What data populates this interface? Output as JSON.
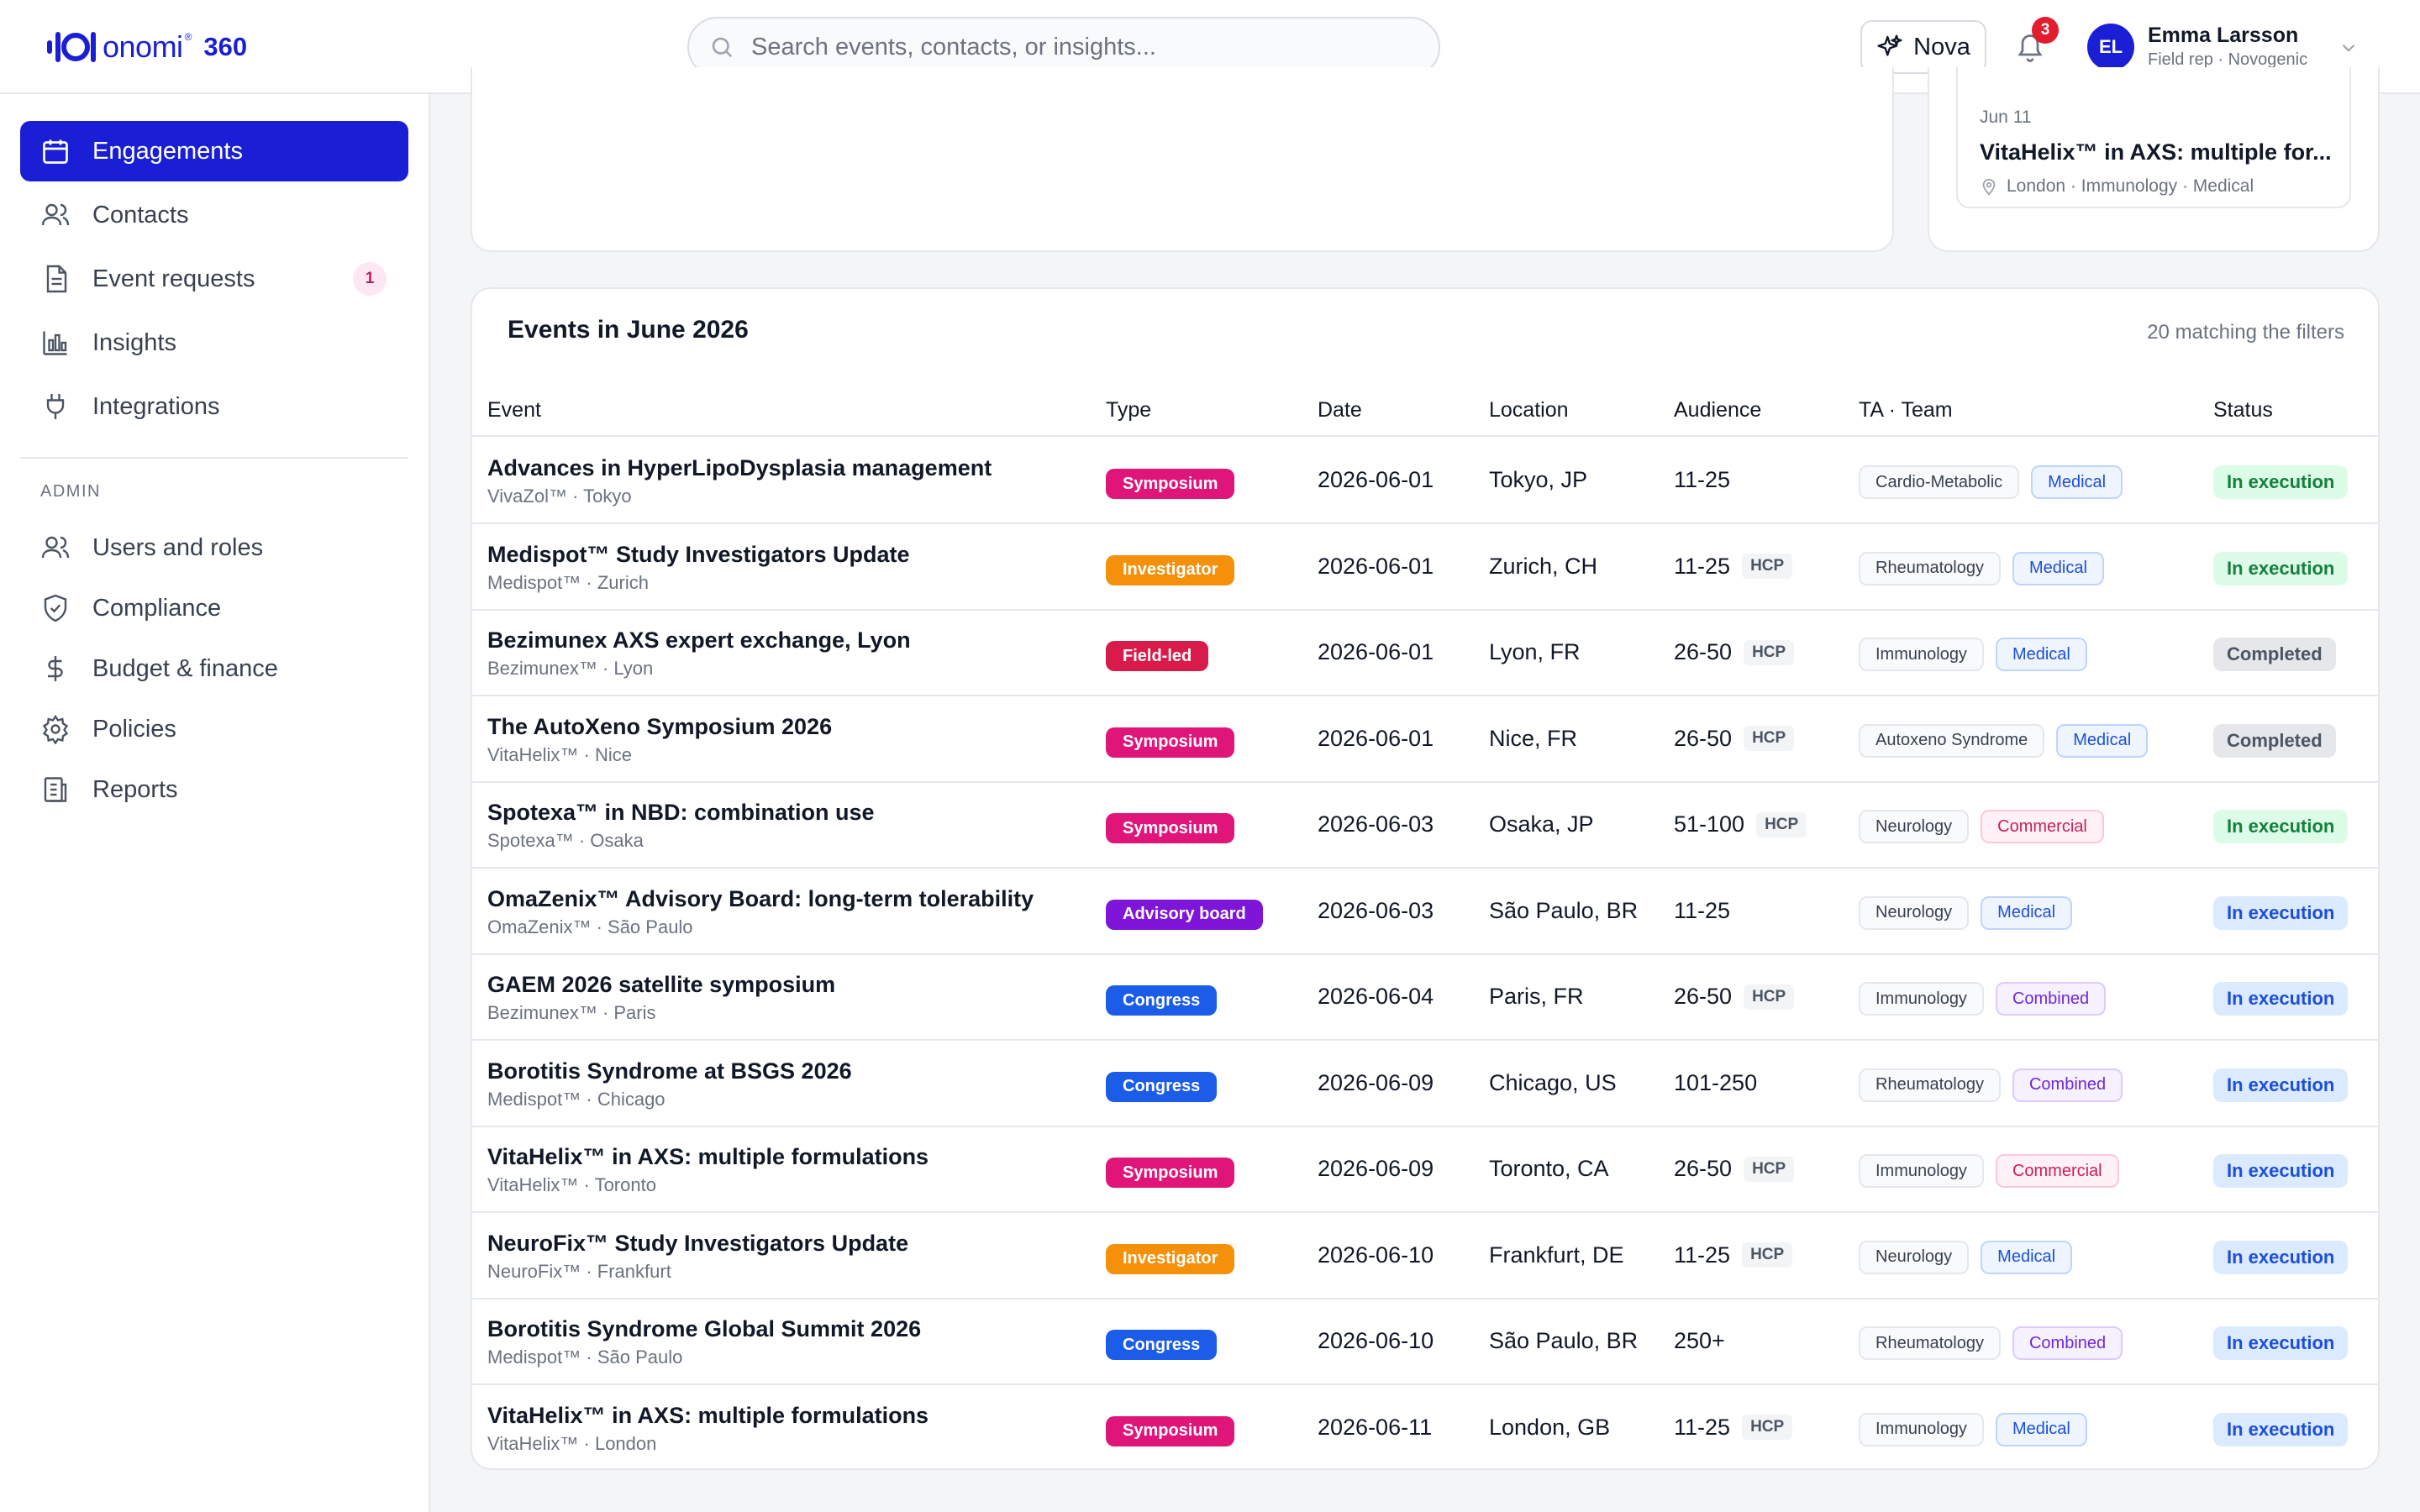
{
  "brand": {
    "name": "onomi",
    "product": "360",
    "reg": "®",
    "accent": "#1a1fd6"
  },
  "search": {
    "placeholder": "Search events, contacts, or insights..."
  },
  "header": {
    "nova_label": "Nova",
    "notifications_count": "3",
    "user": {
      "initials": "EL",
      "name": "Emma Larsson",
      "role": "Field rep · Novogenic"
    }
  },
  "sidebar": {
    "items": [
      {
        "label": "Engagements",
        "icon": "calendar-icon",
        "active": true
      },
      {
        "label": "Contacts",
        "icon": "users-icon"
      },
      {
        "label": "Event requests",
        "icon": "document-icon",
        "badge": "1"
      },
      {
        "label": "Insights",
        "icon": "bar-chart-icon"
      },
      {
        "label": "Integrations",
        "icon": "plug-icon"
      }
    ],
    "admin_label": "ADMIN",
    "admin_items": [
      {
        "label": "Users and roles",
        "icon": "users-icon"
      },
      {
        "label": "Compliance",
        "icon": "shield-icon"
      },
      {
        "label": "Budget & finance",
        "icon": "dollar-icon"
      },
      {
        "label": "Policies",
        "icon": "gear-icon"
      },
      {
        "label": "Reports",
        "icon": "report-icon"
      }
    ]
  },
  "upcoming_card": {
    "date": "Jun 11",
    "title": "VitaHelix™ in AXS: multiple for...",
    "location": "London · Immunology · Medical"
  },
  "events": {
    "title": "Events in June 2026",
    "count_label": "20 matching the filters",
    "columns": {
      "event": "Event",
      "type": "Type",
      "date": "Date",
      "location": "Location",
      "audience": "Audience",
      "ta_team": "TA · Team",
      "status": "Status"
    },
    "type_colors": {
      "Symposium": "#e0157a",
      "Investigator": "#f5900a",
      "Field-led": "#d81b4b",
      "Advisory board": "#7e15d8",
      "Congress": "#1b5ce8"
    },
    "rows": [
      {
        "title": "Advances in HyperLipoDysplasia management",
        "sub": "VivaZol™ · Tokyo",
        "type": "Symposium",
        "date": "2026-06-01",
        "location": "Tokyo, JP",
        "audience": "11-25",
        "hcp": "",
        "ta": "Cardio-Metabolic",
        "team": "Medical",
        "status": "In execution",
        "status_tone": "green"
      },
      {
        "title": "Medispot™ Study Investigators Update",
        "sub": "Medispot™ · Zurich",
        "type": "Investigator",
        "date": "2026-06-01",
        "location": "Zurich, CH",
        "audience": "11-25",
        "hcp": "HCP",
        "ta": "Rheumatology",
        "team": "Medical",
        "status": "In execution",
        "status_tone": "green"
      },
      {
        "title": "Bezimunex AXS expert exchange, Lyon",
        "sub": "Bezimunex™ · Lyon",
        "type": "Field-led",
        "date": "2026-06-01",
        "location": "Lyon, FR",
        "audience": "26-50",
        "hcp": "HCP",
        "ta": "Immunology",
        "team": "Medical",
        "status": "Completed",
        "status_tone": "gray"
      },
      {
        "title": "The AutoXeno Symposium 2026",
        "sub": "VitaHelix™ · Nice",
        "type": "Symposium",
        "date": "2026-06-01",
        "location": "Nice, FR",
        "audience": "26-50",
        "hcp": "HCP",
        "ta": "Autoxeno Syndrome",
        "team": "Medical",
        "status": "Completed",
        "status_tone": "gray"
      },
      {
        "title": "Spotexa™ in NBD: combination use",
        "sub": "Spotexa™ · Osaka",
        "type": "Symposium",
        "date": "2026-06-03",
        "location": "Osaka, JP",
        "audience": "51-100",
        "hcp": "HCP",
        "ta": "Neurology",
        "team": "Commercial",
        "status": "In execution",
        "status_tone": "green"
      },
      {
        "title": "OmaZenix™ Advisory Board: long-term tolerability",
        "sub": "OmaZenix™ · São Paulo",
        "type": "Advisory board",
        "date": "2026-06-03",
        "location": "São Paulo, BR",
        "audience": "11-25",
        "hcp": "",
        "ta": "Neurology",
        "team": "Medical",
        "status": "In execution",
        "status_tone": "blue"
      },
      {
        "title": "GAEM 2026 satellite symposium",
        "sub": "Bezimunex™ · Paris",
        "type": "Congress",
        "date": "2026-06-04",
        "location": "Paris, FR",
        "audience": "26-50",
        "hcp": "HCP",
        "ta": "Immunology",
        "team": "Combined",
        "status": "In execution",
        "status_tone": "blue"
      },
      {
        "title": "Borotitis Syndrome at BSGS 2026",
        "sub": "Medispot™ · Chicago",
        "type": "Congress",
        "date": "2026-06-09",
        "location": "Chicago, US",
        "audience": "101-250",
        "hcp": "",
        "ta": "Rheumatology",
        "team": "Combined",
        "status": "In execution",
        "status_tone": "blue"
      },
      {
        "title": "VitaHelix™ in AXS: multiple formulations",
        "sub": "VitaHelix™ · Toronto",
        "type": "Symposium",
        "date": "2026-06-09",
        "location": "Toronto, CA",
        "audience": "26-50",
        "hcp": "HCP",
        "ta": "Immunology",
        "team": "Commercial",
        "status": "In execution",
        "status_tone": "blue"
      },
      {
        "title": "NeuroFix™ Study Investigators Update",
        "sub": "NeuroFix™ · Frankfurt",
        "type": "Investigator",
        "date": "2026-06-10",
        "location": "Frankfurt, DE",
        "audience": "11-25",
        "hcp": "HCP",
        "ta": "Neurology",
        "team": "Medical",
        "status": "In execution",
        "status_tone": "blue"
      },
      {
        "title": "Borotitis Syndrome Global Summit 2026",
        "sub": "Medispot™ · São Paulo",
        "type": "Congress",
        "date": "2026-06-10",
        "location": "São Paulo, BR",
        "audience": "250+",
        "hcp": "",
        "ta": "Rheumatology",
        "team": "Combined",
        "status": "In execution",
        "status_tone": "blue"
      },
      {
        "title": "VitaHelix™ in AXS: multiple formulations",
        "sub": "VitaHelix™ · London",
        "type": "Symposium",
        "date": "2026-06-11",
        "location": "London, GB",
        "audience": "11-25",
        "hcp": "HCP",
        "ta": "Immunology",
        "team": "Medical",
        "status": "In execution",
        "status_tone": "blue"
      }
    ]
  }
}
